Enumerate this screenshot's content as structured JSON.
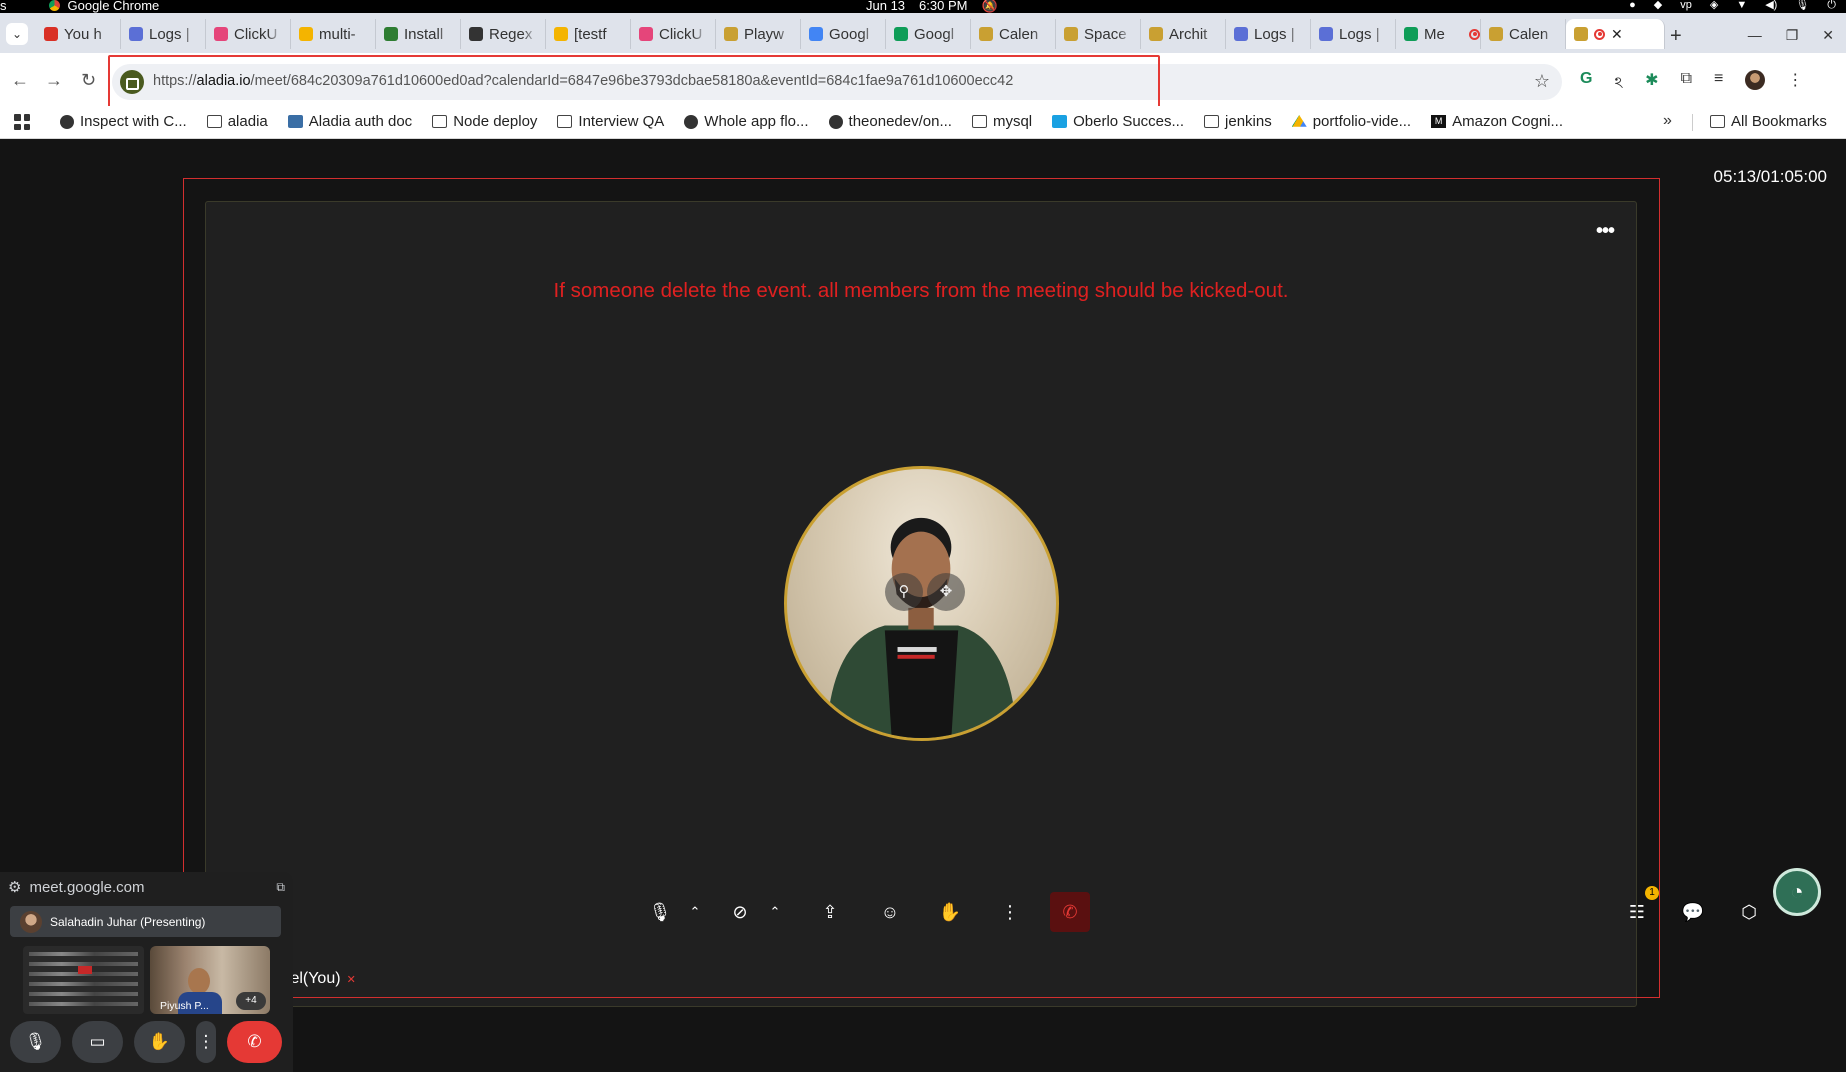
{
  "os": {
    "left_text": "s",
    "app_name": "Google Chrome",
    "date": "Jun 13",
    "time": "6:30 PM"
  },
  "tabs": [
    {
      "title": "You h",
      "icon": "gmail-icon",
      "color": "#d93025"
    },
    {
      "title": "Logs |",
      "icon": "list-icon",
      "color": "#5b6fd6"
    },
    {
      "title": "ClickU",
      "icon": "clickup-icon",
      "color": "#e5457a"
    },
    {
      "title": "multi-",
      "icon": "chrome-icon",
      "color": "#f4b400"
    },
    {
      "title": "Install",
      "icon": "leaf-icon",
      "color": "#2e7d32"
    },
    {
      "title": "Regex",
      "icon": "circle-icon",
      "color": "#333333"
    },
    {
      "title": "[testf",
      "icon": "chrome-icon",
      "color": "#f4b400"
    },
    {
      "title": "ClickU",
      "icon": "clickup-icon",
      "color": "#e5457a"
    },
    {
      "title": "Playw",
      "icon": "playwright-icon",
      "color": "#c9a032"
    },
    {
      "title": "Googl",
      "icon": "gemini-icon",
      "color": "#4285f4"
    },
    {
      "title": "Googl",
      "icon": "meet-icon",
      "color": "#0f9d58"
    },
    {
      "title": "Calen",
      "icon": "aladia-icon",
      "color": "#c9a032"
    },
    {
      "title": "Space",
      "icon": "aladia-icon",
      "color": "#c9a032"
    },
    {
      "title": "Archit",
      "icon": "aladia-icon",
      "color": "#c9a032"
    },
    {
      "title": "Logs |",
      "icon": "list-icon",
      "color": "#5b6fd6"
    },
    {
      "title": "Logs |",
      "icon": "list-icon",
      "color": "#5b6fd6"
    },
    {
      "title": "Me",
      "icon": "meet-icon",
      "color": "#0f9d58"
    },
    {
      "title": "Calen",
      "icon": "aladia-icon",
      "color": "#c9a032"
    }
  ],
  "active_tab": {
    "icon": "aladia-icon",
    "close": "✕"
  },
  "address": {
    "prefix": "https://",
    "host": "aladia.io",
    "path": "/meet/684c20309a761d10600ed0ad?calendarId=6847e96be3793dcbae58180a&eventId=684c1fae9a761d10600ecc42"
  },
  "bookmarks": [
    {
      "label": "Inspect with C...",
      "icon": "globe-icon"
    },
    {
      "label": "aladia",
      "icon": "folder-icon"
    },
    {
      "label": "Aladia auth doc",
      "icon": "image-icon"
    },
    {
      "label": "Node deploy",
      "icon": "folder-icon"
    },
    {
      "label": "Interview QA",
      "icon": "folder-icon"
    },
    {
      "label": "Whole app flo...",
      "icon": "globe-icon"
    },
    {
      "label": "theonedev/on...",
      "icon": "github-icon"
    },
    {
      "label": "mysql",
      "icon": "folder-icon"
    },
    {
      "label": "Oberlo Succes...",
      "icon": "cube-icon"
    },
    {
      "label": "jenkins",
      "icon": "folder-icon"
    },
    {
      "label": "portfolio-vide...",
      "icon": "drive-icon"
    },
    {
      "label": "Amazon Cogni...",
      "icon": "medium-icon"
    }
  ],
  "bookmarks_more": "»",
  "all_bookmarks": "All Bookmarks",
  "meeting": {
    "timer": "05:13/01:05:00",
    "notice": "If someone delete the event. all members from the meeting should be kicked-out.",
    "participant_label": "tel(You)",
    "participants_badge": "1"
  },
  "pip": {
    "source": "meet.google.com",
    "presenting": "Salahadin Juhar (Presenting)",
    "tile_name": "Piyush P...",
    "more_count": "+4"
  }
}
